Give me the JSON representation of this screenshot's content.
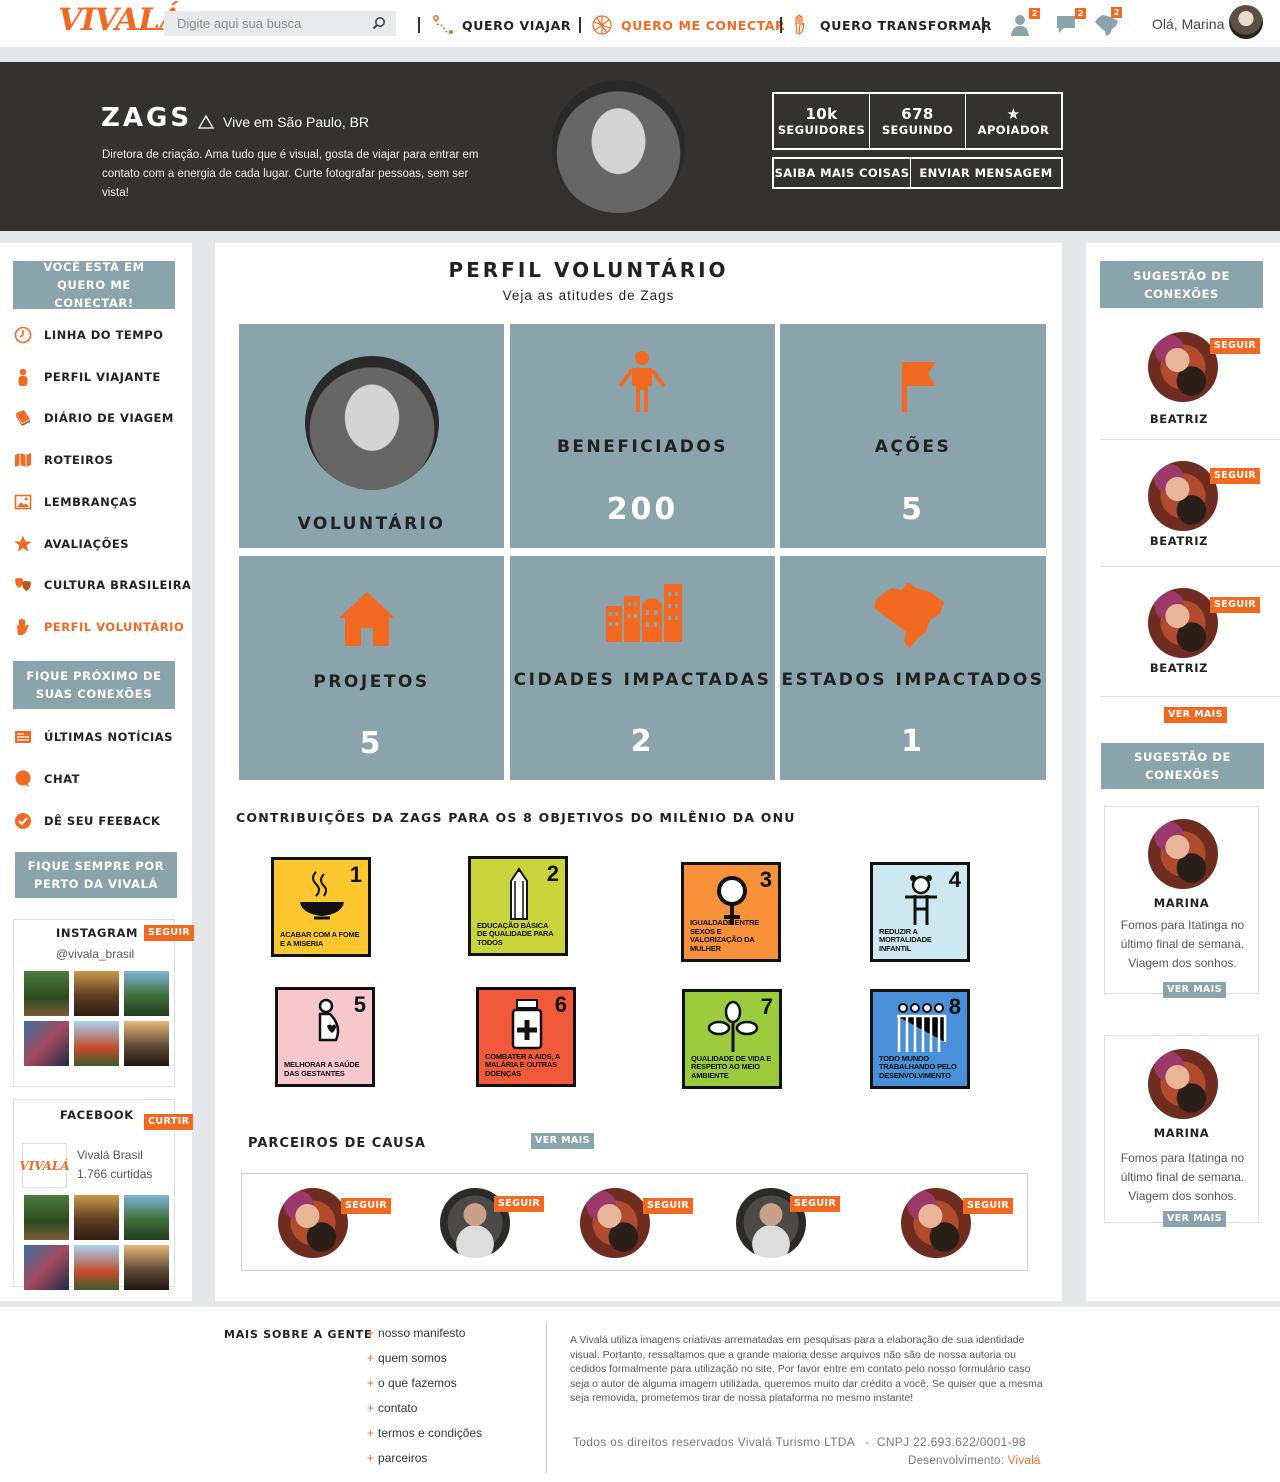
{
  "topbar": {
    "logo": "VIVALÁ",
    "search_placeholder": "Digite aqui sua busca",
    "nav": [
      "QUERO VIAJAR",
      "QUERO ME CONECTAR",
      "QUERO TRANSFORMAR"
    ],
    "badges": [
      "2",
      "2",
      "2"
    ],
    "greeting": "Olá, Marina"
  },
  "profile": {
    "name": "ZAGS",
    "location": "Vive em São Paulo, BR",
    "bio": "Diretora de criação. Ama tudo que é visual, gosta de viajar para entrar em contato com a energia de cada lugar. Curte fotografar pessoas, sem ser vista!",
    "stats": [
      {
        "value": "10k",
        "label": "SEGUIDORES"
      },
      {
        "value": "678",
        "label": "SEGUINDO"
      },
      {
        "value": "★",
        "label": "APOIADOR"
      }
    ],
    "actions": [
      "SAIBA MAIS COISAS",
      "ENVIAR MENSAGEM"
    ]
  },
  "left": {
    "header1": "VOCÊ ESTÁ EM QUERO ME CONECTAR!",
    "menu": [
      {
        "label": "LINHA DO TEMPO",
        "icon": "clock-icon"
      },
      {
        "label": "PERFIL VIAJANTE",
        "icon": "person-icon"
      },
      {
        "label": "DIÁRIO DE VIAGEM",
        "icon": "book-icon"
      },
      {
        "label": "ROTEIROS",
        "icon": "map-icon"
      },
      {
        "label": "LEMBRANÇAS",
        "icon": "picture-icon"
      },
      {
        "label": "AVALIAÇÕES",
        "icon": "star-icon"
      },
      {
        "label": "CULTURA BRASILEIRA",
        "icon": "masks-icon"
      },
      {
        "label": "PERFIL VOLUNTÁRIO",
        "icon": "hand-icon"
      }
    ],
    "header2": "FIQUE PRÓXIMO DE SUAS CONEXÕES",
    "menu2": [
      {
        "label": "ÚLTIMAS NOTÍCIAS",
        "icon": "news-icon"
      },
      {
        "label": "CHAT",
        "icon": "chat-icon"
      },
      {
        "label": "DÊ SEU FEEBACK",
        "icon": "check-icon"
      }
    ],
    "header3": "FIQUE SEMPRE POR PERTO DA VIVALÁ",
    "instagram": {
      "title": "INSTAGRAM",
      "button": "SEGUIR",
      "handle": "@vivala_brasil"
    },
    "facebook": {
      "title": "FACEBOOK",
      "button": "CURTIR",
      "page": "Vivalá Brasil",
      "likes": "1.766 curtidas",
      "logo": "VIVALÁ"
    }
  },
  "main": {
    "title": "PERFIL VOLUNTÁRIO",
    "subtitle": "Veja as atitudes de Zags",
    "tiles": [
      {
        "label": "VOLUNTÁRIO",
        "value": ""
      },
      {
        "label": "BENEFICIADOS",
        "value": "200"
      },
      {
        "label": "AÇÕES",
        "value": "5"
      },
      {
        "label": "PROJETOS",
        "value": "5"
      },
      {
        "label": "CIDADES IMPACTADAS",
        "value": "2"
      },
      {
        "label": "ESTADOS IMPACTADOS",
        "value": "1"
      }
    ],
    "mdg_title": "CONTRIBUIÇÕES DA ZAGS PARA OS 8 OBJETIVOS DO MILÊNIO DA ONU",
    "mdgs": [
      {
        "num": "1",
        "text": "ACABAR COM A FOME E A MISERIA",
        "color": "#fdc82f"
      },
      {
        "num": "2",
        "text": "EDUCAÇÃO BÁSICA DE QUALIDADE PARA TODOS",
        "color": "#c9d43d"
      },
      {
        "num": "3",
        "text": "IGUALDADE ENTRE SEXOS E VALORIZAÇÃO DA MULHER",
        "color": "#f7923a"
      },
      {
        "num": "4",
        "text": "REDUZIR A MORTALIDADE INFANTIL",
        "color": "#cde8ef"
      },
      {
        "num": "5",
        "text": "MELHORAR A SAÚDE DAS GESTANTES",
        "color": "#f6c8cd"
      },
      {
        "num": "6",
        "text": "COMBATER A AIDS, A MALÁRIA E OUTRAS DOENÇAS",
        "color": "#f0593a"
      },
      {
        "num": "7",
        "text": "QUALIDADE DE VIDA E RESPEITO AO MEIO AMBIENTE",
        "color": "#9ccc3d"
      },
      {
        "num": "8",
        "text": "TODO MUNDO TRABALHANDO PELO DESENVOLVIMENTO",
        "color": "#4a90d9"
      }
    ],
    "partners_title": "PARCEIROS DE CAUSA",
    "partners_more": "VER MAIS",
    "follow": "SEGUIR"
  },
  "right": {
    "header": "SUGESTÃO DE CONEXÕES",
    "suggestions": [
      "BEATRIZ",
      "BEATRIZ",
      "BEATRIZ"
    ],
    "follow": "SEGUIR",
    "more": "VER MAIS",
    "header2": "SUGESTÃO DE CONEXÕES",
    "posts": [
      {
        "name": "MARINA",
        "text": "Fomos para Itatinga no último final de semana. Viagem dos sonhos."
      },
      {
        "name": "MARINA",
        "text": "Fomos para Itatinga no último final de semana. Viagem dos sonhos."
      }
    ]
  },
  "footer": {
    "title": "MAIS SOBRE A GENTE",
    "links": [
      "nosso manifesto",
      "quem somos",
      "o que fazemos",
      "contato",
      "termos e condições",
      "parceiros"
    ],
    "disclaimer": "A Vivalá utiliza imagens criativas arrematadas em pesquisas para a elaboração de sua identidade visual. Portanto, ressaltamos que a grande maioria desse arquivos não são de nossa autoria ou cedidos formalmente para utilização no site. Por favor entre em contato pelo nosso formulário caso seja o autor de alguma imagem utilizada, queremos muito dar crédito a você. Se quiser que a mesma seja removida, prometemos tirar de nossa plataforma no mesmo instante!",
    "copyright": "Todos os direitos reservados Vivalá Turismo LTDA   -  CNPJ 22.693.622/0001-98",
    "dev_label": "Desenvolvimento:",
    "dev_name": "Vivalá"
  },
  "colors": {
    "accent": "#f26a22",
    "slate": "#8ba4ab",
    "hero": "#333230"
  }
}
